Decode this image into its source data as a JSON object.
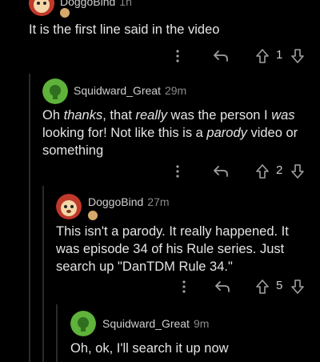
{
  "comments": [
    {
      "author": "DoggoBind",
      "time": "1h",
      "text": "It is the first line said in the video",
      "votes": "1"
    },
    {
      "author": "Squidward_Great",
      "time": "29m",
      "text_parts": [
        "Oh ",
        "thanks",
        ", that ",
        "really",
        " was the person I ",
        "was",
        " looking for! Not like this is a ",
        "parody",
        " video or something"
      ],
      "votes": "2"
    },
    {
      "author": "DoggoBind",
      "time": "27m",
      "text": "This isn't a parody. It really happened. It was episode 34 of his Rule series.  Just search up \"DanTDM Rule 34.\"",
      "votes": "5"
    },
    {
      "author": "Squidward_Great",
      "time": "9m",
      "text": "Oh, ok, I'll search it up now"
    }
  ],
  "icons": {
    "more": "more-options-icon",
    "reply": "reply-arrow-icon",
    "upvote": "upvote-arrow-icon",
    "downvote": "downvote-arrow-icon"
  },
  "colors": {
    "background": "#000000",
    "squidward_avatar": "#5fb23a",
    "doggo_avatar": "#c0392b"
  }
}
